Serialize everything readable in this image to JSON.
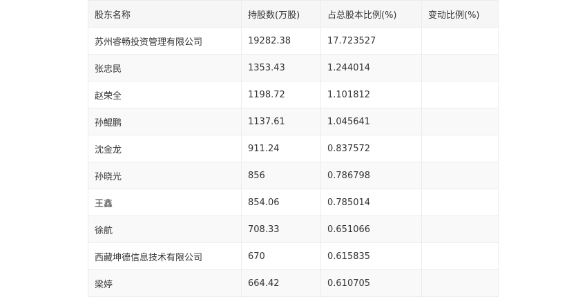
{
  "table": {
    "headers": [
      "股东名称",
      "持股数(万股)",
      "占总股本比例(%)",
      "变动比例(%)"
    ],
    "rows": [
      [
        "苏州睿畅投资管理有限公司",
        "19282.38",
        "17.723527",
        ""
      ],
      [
        "张忠民",
        "1353.43",
        "1.244014",
        ""
      ],
      [
        "赵荣全",
        "1198.72",
        "1.101812",
        ""
      ],
      [
        "孙鲲鹏",
        "1137.61",
        "1.045641",
        ""
      ],
      [
        "沈金龙",
        "911.24",
        "0.837572",
        ""
      ],
      [
        "孙晓光",
        "856",
        "0.786798",
        ""
      ],
      [
        "王鑫",
        "854.06",
        "0.785014",
        ""
      ],
      [
        "徐航",
        "708.33",
        "0.651066",
        ""
      ],
      [
        "西藏坤德信息技术有限公司",
        "670",
        "0.615835",
        ""
      ],
      [
        "梁婷",
        "664.42",
        "0.610705",
        ""
      ]
    ]
  }
}
